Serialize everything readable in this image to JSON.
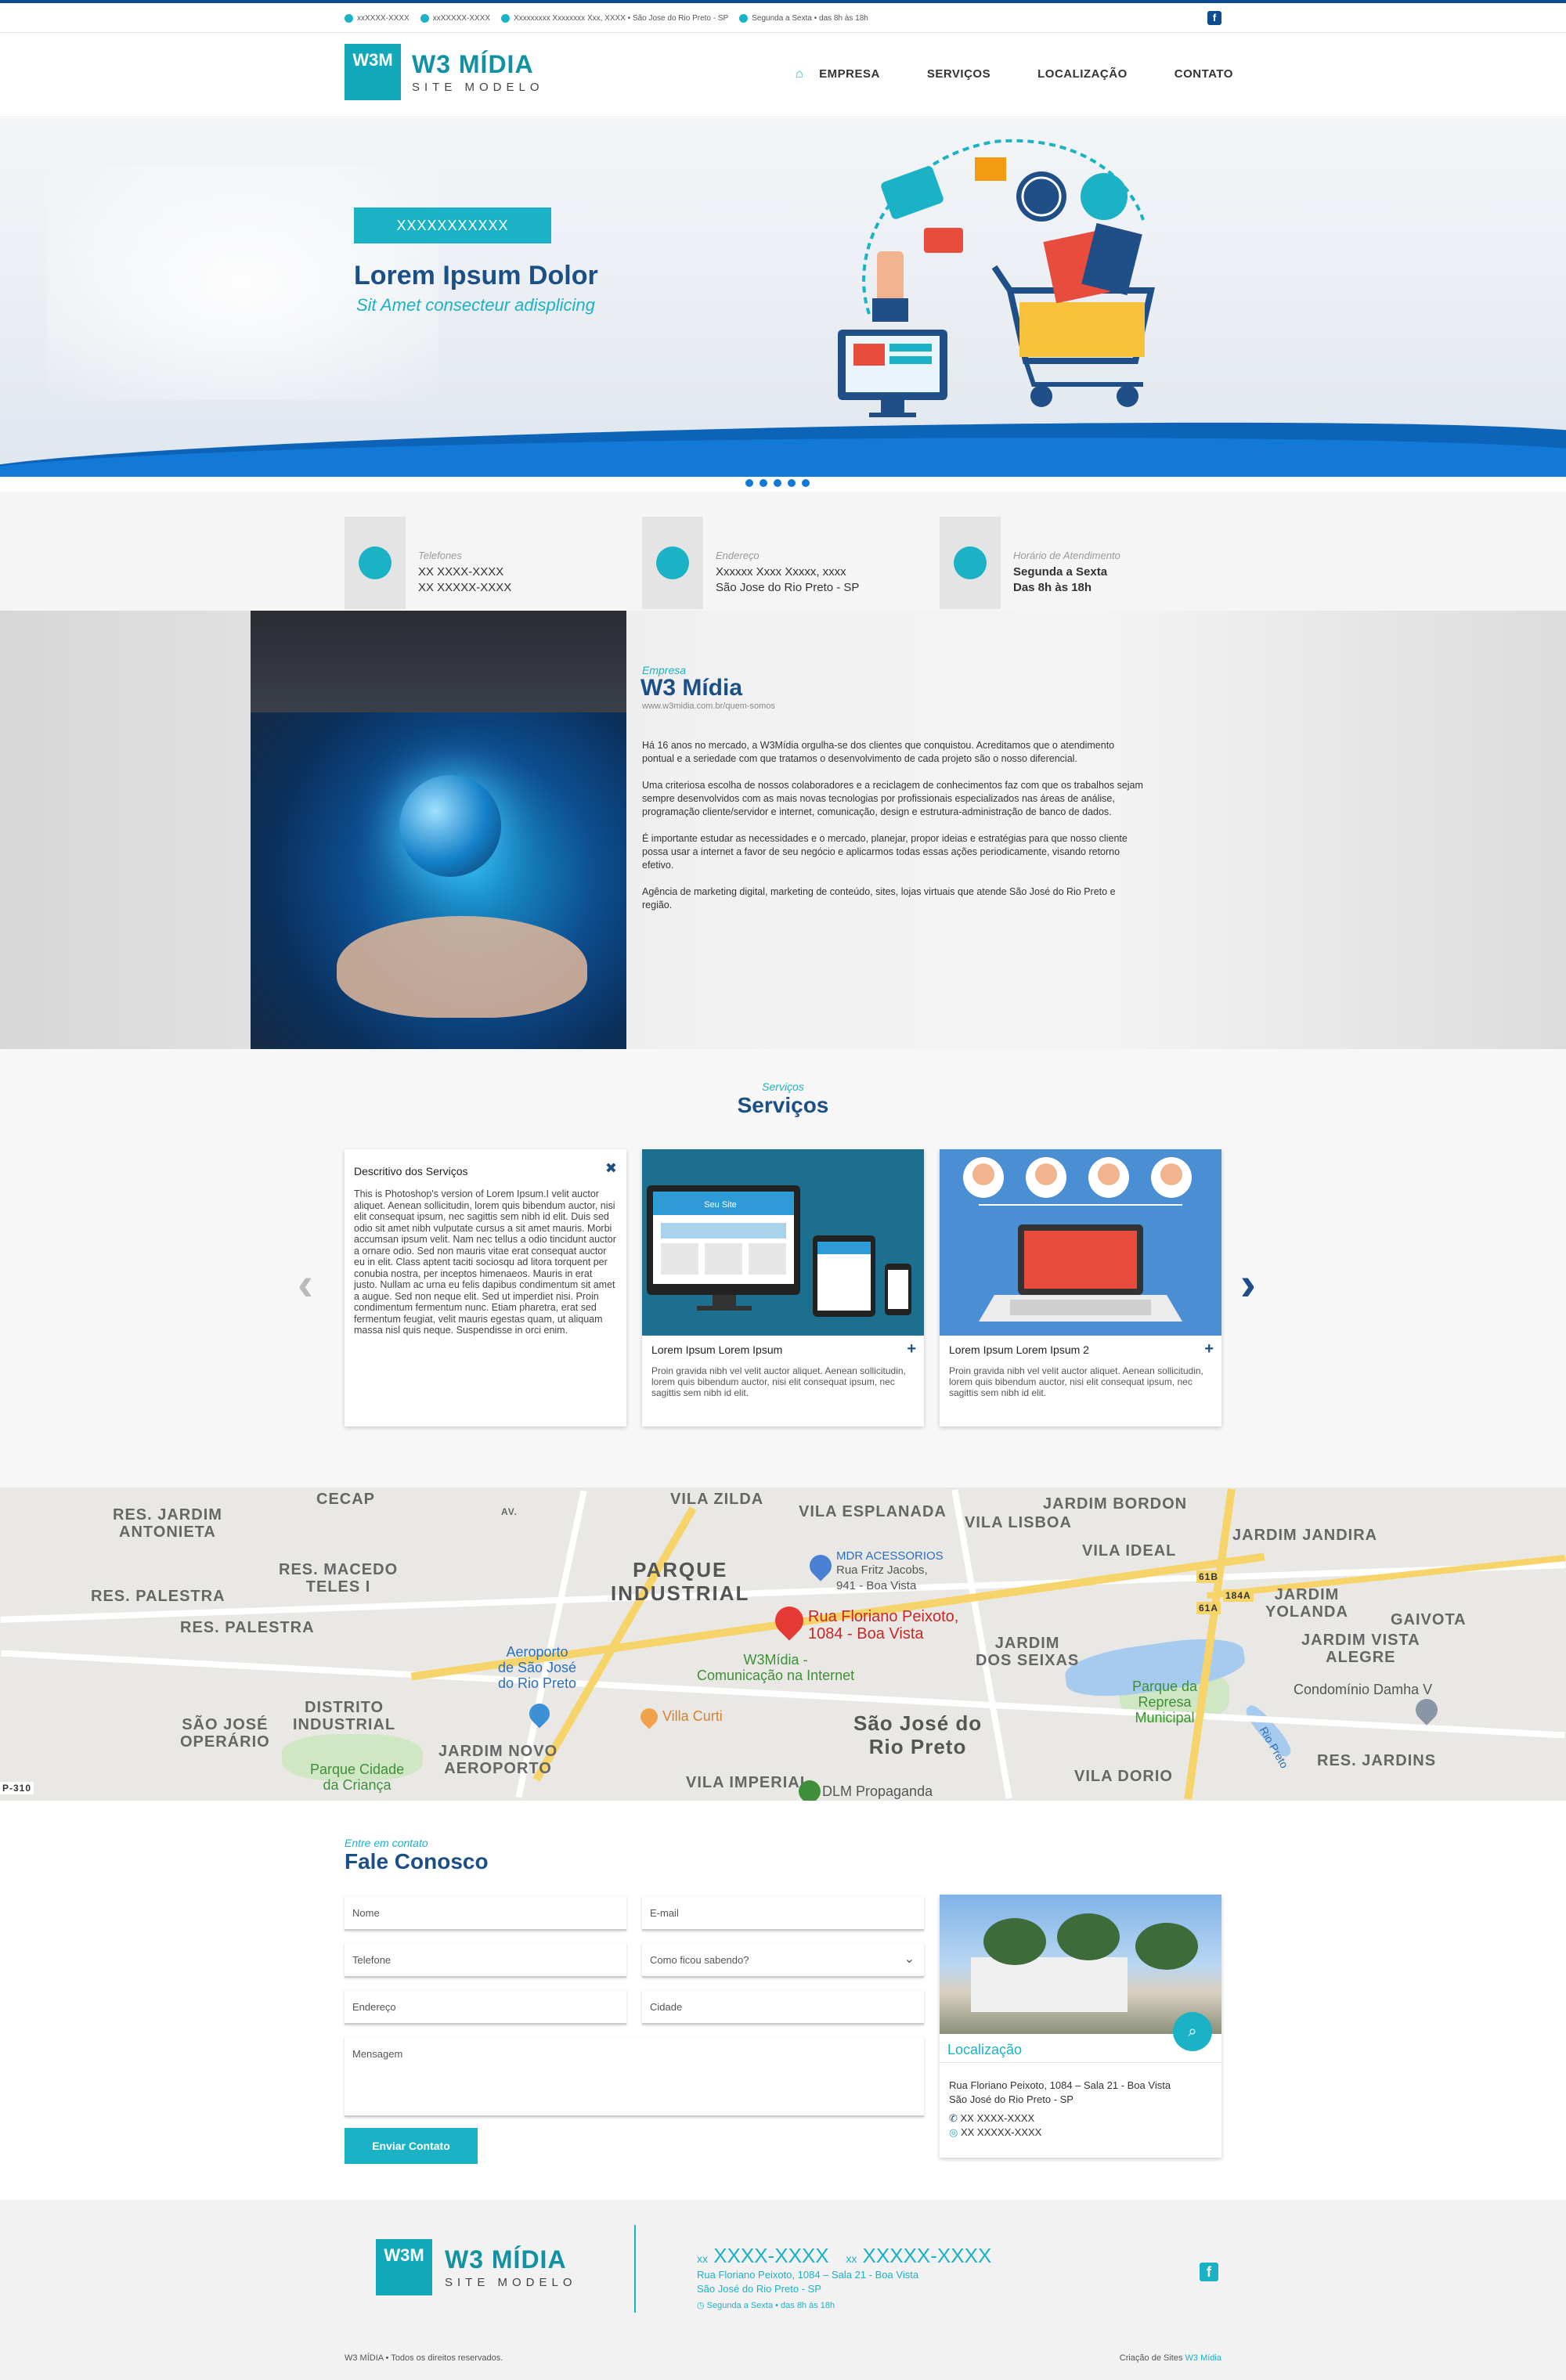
{
  "topbar": {
    "phone": "xxXXXX-XXXX",
    "whatsapp": "xxXXXXX-XXXX",
    "address": "Xxxxxxxxx Xxxxxxxx Xxx, XXXX • São Jose do Rio Preto - SP",
    "hours": "Segunda a Sexta • das 8h às 18h"
  },
  "logo": {
    "line1": "W3 MÍDIA",
    "line2": "SITE MODELO",
    "mark": "W3M"
  },
  "nav": {
    "empresa": "EMPRESA",
    "servicos": "SERVIÇOS",
    "localizacao": "LOCALIZAÇÃO",
    "contato": "CONTATO"
  },
  "hero": {
    "tag": "XXXXXXXXXXX",
    "title": "Lorem Ipsum Dolor",
    "subtitle": "Sit Amet consecteur adisplicing"
  },
  "info": {
    "phones": {
      "label": "Telefones",
      "v1": "XX XXXX-XXXX",
      "v2": "XX XXXXX-XXXX"
    },
    "address": {
      "label": "Endereço",
      "v1": "Xxxxxx Xxxx Xxxxx, xxxx",
      "v2": "São Jose do Rio Preto - SP"
    },
    "hours": {
      "label": "Horário de Atendimento",
      "v1": "Segunda a Sexta",
      "v2": "Das 8h às 18h"
    }
  },
  "empresa": {
    "label": "Empresa",
    "title": "W3 Mídia",
    "url": "www.w3midia.com.br/quem-somos",
    "p1": "Há 16 anos no mercado, a W3Mídia orgulha-se dos clientes que conquistou. Acreditamos que o atendimento pontual e a seriedade com que tratamos o desenvolvimento de cada projeto são o nosso diferencial.",
    "p2": "Uma criteriosa escolha de nossos colaboradores e a reciclagem de conhecimentos faz com que os trabalhos sejam sempre desenvolvidos com as mais novas tecnologias por profissionais especializados nas áreas de análise, programação cliente/servidor e internet, comunicação, design e estrutura-administração de banco de dados.",
    "p3": "É importante estudar as necessidades e o mercado, planejar, propor ideias e estratégias para que nosso cliente possa usar a internet a favor de seu negócio e aplicarmos todas essas ações periodicamente, visando retorno efetivo.",
    "p4": "Agência de marketing digital, marketing de conteúdo, sites, lojas virtuais que atende São José do Rio Preto e região."
  },
  "servicos": {
    "label": "Serviços",
    "title": "Serviços",
    "card1": {
      "title": "Descritivo dos Serviços",
      "text": "This is Photoshop's version  of Lorem Ipsum.I velit auctor aliquet. Aenean sollicitudin, lorem quis bibendum auctor, nisi elit consequat ipsum, nec sagittis sem nibh id elit. Duis sed odio sit amet nibh vulputate cursus a sit amet mauris. Morbi accumsan ipsum velit. Nam nec tellus a odio tincidunt auctor a ornare odio. Sed non  mauris vitae erat consequat auctor eu in elit. Class aptent taciti sociosqu ad litora torquent per conubia nostra, per inceptos himenaeos. Mauris in erat justo. Nullam ac urna eu felis dapibus condimentum sit amet a augue. Sed non neque elit. Sed ut imperdiet nisi. Proin condimentum fermentum nunc. Etiam pharetra, erat sed fermentum feugiat, velit mauris egestas quam, ut aliquam massa nisl quis neque. Suspendisse in orci enim."
    },
    "card2": {
      "title": "Lorem Ipsum Lorem Ipsum",
      "image_label": "Seu Site",
      "text": "Proin gravida nibh vel velit auctor aliquet. Aenean sollicitudin, lorem quis bibendum auctor, nisi elit consequat ipsum, nec sagittis sem nibh id elit."
    },
    "card3": {
      "title": "Lorem Ipsum Lorem Ipsum 2",
      "text": "Proin gravida nibh vel velit auctor aliquet. Aenean sollicitudin, lorem quis bibendum auctor, nisi elit consequat ipsum, nec sagittis sem nibh id elit."
    }
  },
  "map": {
    "labels": {
      "cecap": "CECAP",
      "vila_zilda": "VILA ZILDA",
      "vila_esplanada": "VILA ESPLANADA",
      "jardim_bordon": "JARDIM BORDON",
      "vila_lisboa": "VILA LISBOA",
      "jardim_jandira": "JARDIM JANDIRA",
      "res_jardim_antonieta": "RES. JARDIM\nANTONIETA",
      "res_macedo_teles": "RES. MACEDO\nTELES I",
      "res_palestra1": "RES. PALESTRA",
      "res_palestra2": "RES. PALESTRA",
      "parque_industrial": "PARQUE\nINDUSTRIAL",
      "vila_ideal": "VILA IDEAL",
      "jardim_yolanda": "JARDIM\nYOLANDA",
      "gaivota": "GAIVOTA",
      "jardim_vista_alegre": "JARDIM VISTA\nALEGRE",
      "jardim_dos_seixas": "JARDIM\nDOS SEIXAS",
      "distrito_industrial": "DISTRITO\nINDUSTRIAL",
      "sao_jose_operario": "SÃO JOSÉ\nOPERÁRIO",
      "jardim_novo_aeroporto": "JARDIM NOVO\nAEROPORTO",
      "vila_imperial": "VILA IMPERIAL",
      "vila_dorio": "VILA DORIO",
      "res_jardins": "RES. JARDINS",
      "sao_jose_do_rio_preto": "São José do\nRio Preto",
      "aeroporto": "Aeroporto\nde São José\ndo Rio Preto",
      "parque_cidade_crianca": "Parque Cidade\nda Criança",
      "parque_represa": "Parque da\nRepresa\nMunicipal",
      "villa_curti": "Villa Curti",
      "mdr": "MDR ACESSORIOS",
      "mdr_addr": "Rua Fritz Jacobs,\n941 - Boa Vista",
      "w3midia_red": "Rua Floriano Peixoto,\n1084 - Boa Vista",
      "w3midia_green": "W3Mídia -\nComunicação na Internet",
      "dlm": "DLM Propaganda",
      "condominio_damha": "Condomínio Damha V",
      "rio_preto": "Rio Preto",
      "r61b": "61B",
      "r184a": "184A",
      "r61a": "61A",
      "av": "AV.",
      "p310": "P-310"
    }
  },
  "contato": {
    "label": "Entre em contato",
    "title": "Fale Conosco",
    "fields": {
      "nome": "Nome",
      "email": "E-mail",
      "telefone": "Telefone",
      "como": "Como ficou sabendo?",
      "endereco": "Endereço",
      "cidade": "Cidade",
      "mensagem": "Mensagem"
    },
    "send": "Enviar Contato",
    "loc": {
      "title": "Localização",
      "line1": "Rua Floriano Peixoto, 1084 – Sala 21 - Boa Vista",
      "line2": "São José do Rio Preto - SP",
      "phone": "XX XXXX-XXXX",
      "whats": "XX XXXXX-XXXX"
    }
  },
  "footer": {
    "phone1_prefix": "xx",
    "phone1": "XXXX-XXXX",
    "phone2_prefix": "xx",
    "phone2": "XXXXX-XXXX",
    "addr1": "Rua Floriano Peixoto, 1084 – Sala 21 - Boa Vista",
    "addr2": "São José do Rio Preto - SP",
    "hours": "Segunda a Sexta • das 8h às 18h",
    "copyright": "W3 MÍDIA • Todos os direitos reservados.",
    "credit_prefix": "Criação de Sites",
    "credit_brand": "W3 Mídia"
  },
  "colors": {
    "accent": "#1ab2c4",
    "brand": "#1b4f86",
    "wave": "#0d63b8"
  }
}
